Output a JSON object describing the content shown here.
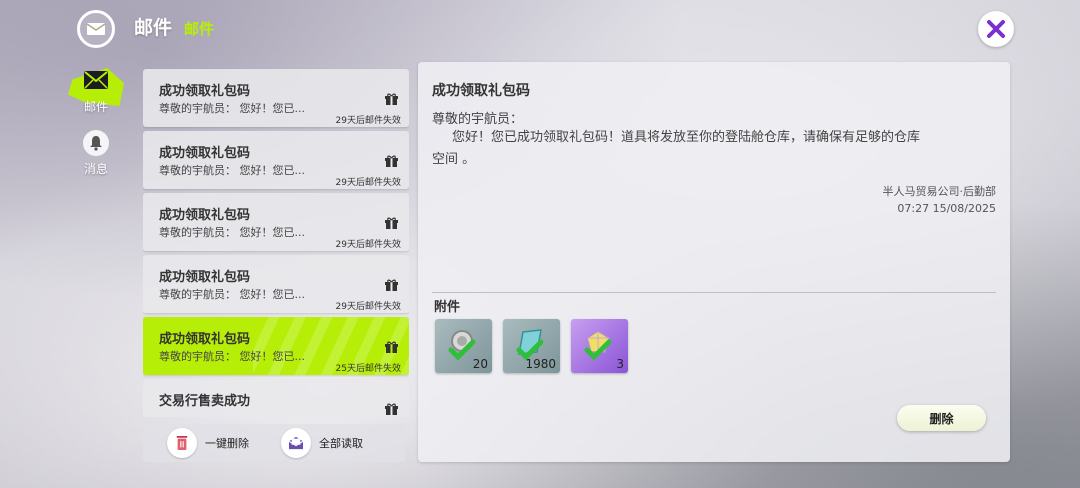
{
  "header": {
    "title": "邮件",
    "subtitle": "邮件",
    "logo_icon": "mail-logo-icon",
    "close_icon": "close-icon"
  },
  "nav": {
    "items": [
      {
        "label": "邮件",
        "icon": "mail-icon",
        "active": true
      },
      {
        "label": "消息",
        "icon": "bell-icon",
        "active": false
      }
    ]
  },
  "mail_list": {
    "items": [
      {
        "title": "成功领取礼包码",
        "preview": "尊敬的宇航员：     您好！您已...",
        "expire": "29天后邮件失效",
        "icon": "gift-icon"
      },
      {
        "title": "成功领取礼包码",
        "preview": "尊敬的宇航员：     您好！您已...",
        "expire": "29天后邮件失效",
        "icon": "gift-icon"
      },
      {
        "title": "成功领取礼包码",
        "preview": "尊敬的宇航员：     您好！您已...",
        "expire": "29天后邮件失效",
        "icon": "gift-icon"
      },
      {
        "title": "成功领取礼包码",
        "preview": "尊敬的宇航员：     您好！您已...",
        "expire": "29天后邮件失效",
        "icon": "gift-icon"
      },
      {
        "title": "成功领取礼包码",
        "preview": "尊敬的宇航员：     您好！您已...",
        "expire": "25天后邮件失效",
        "icon": "gift-icon",
        "active": true
      },
      {
        "title": "交易行售卖成功",
        "preview": "",
        "expire": "",
        "icon": "gift-icon"
      }
    ]
  },
  "bottom_bar": {
    "delete_all_label": "一键删除",
    "read_all_label": "全部读取"
  },
  "detail": {
    "title": "成功领取礼包码",
    "greeting": "尊敬的宇航员：",
    "body": "您好！您已成功领取礼包码！道具将发放至你的登陆舱仓库，请确保有足够的仓库空间 。",
    "sender": "半人马贸易公司·后勤部",
    "date": "07:27 15/08/2025",
    "attachments_label": "附件",
    "attachments": [
      {
        "count": "20",
        "icon": "medal-item-icon",
        "claimed": true
      },
      {
        "count": "1980",
        "icon": "crystal-item-icon",
        "claimed": true
      },
      {
        "count": "3",
        "icon": "gem-item-icon",
        "claimed": true
      }
    ],
    "delete_label": "删除"
  },
  "colors": {
    "accent": "#b6ee08",
    "claimed_check": "#2fbf3a"
  }
}
